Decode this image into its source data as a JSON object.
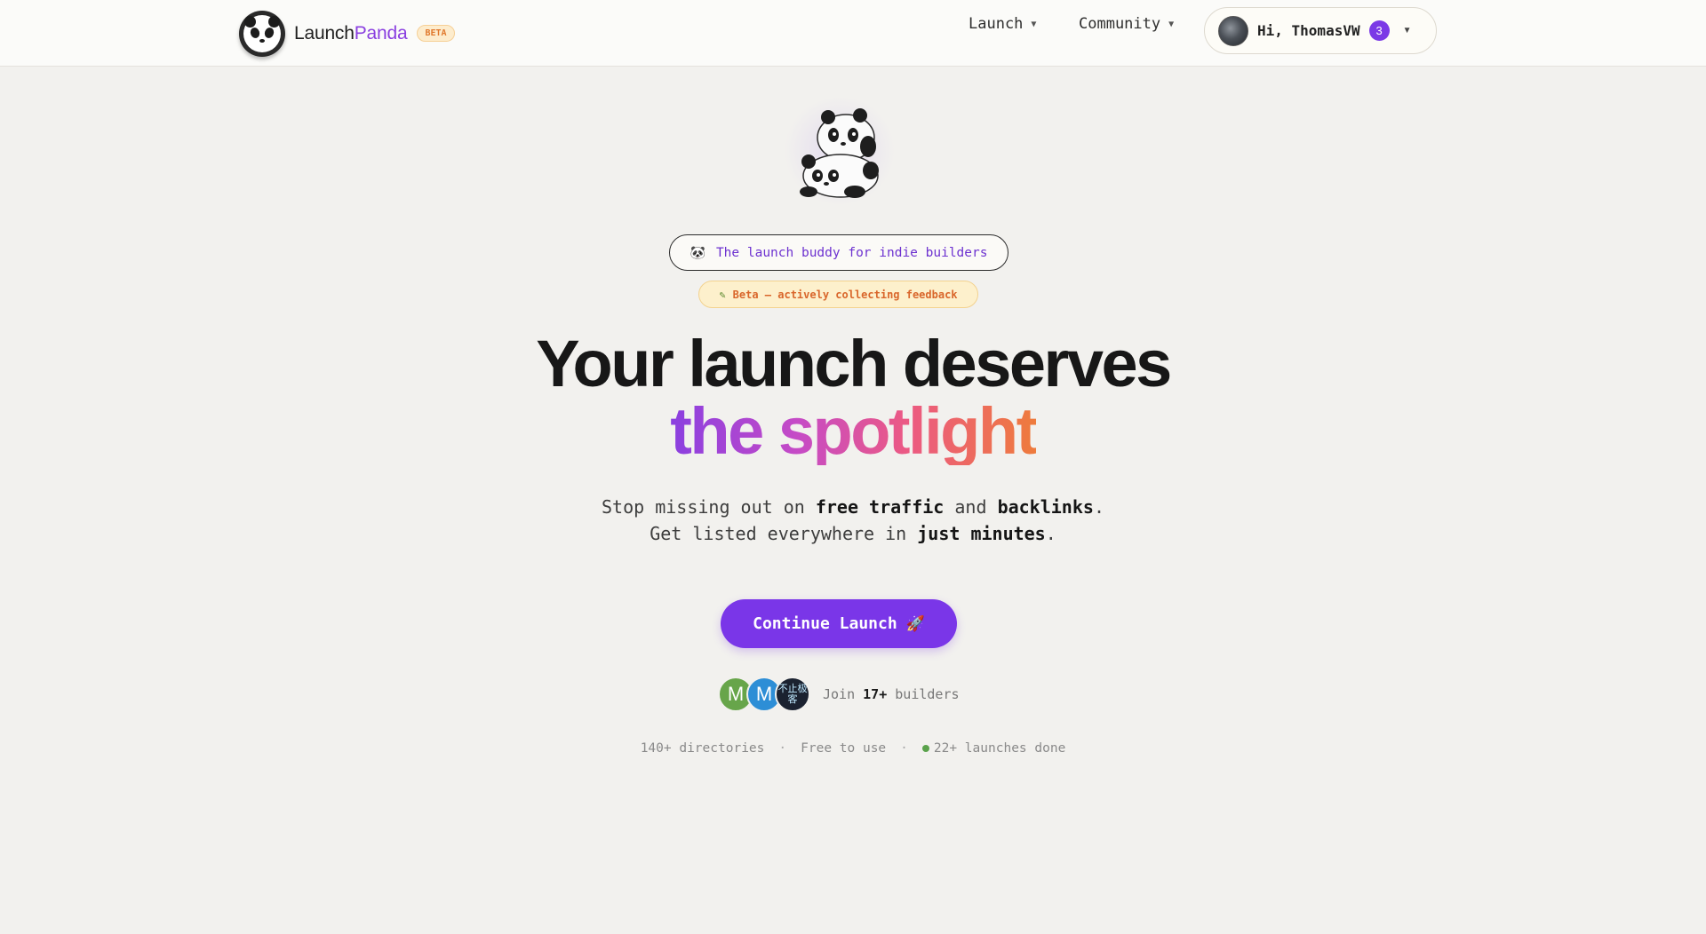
{
  "header": {
    "brand_part1": "Launch",
    "brand_part2": "Panda",
    "beta_badge": "BETA",
    "nav": [
      {
        "label": "Launch"
      },
      {
        "label": "Community"
      }
    ],
    "user": {
      "greeting": "Hi, ThomasVW",
      "notification_count": "3"
    }
  },
  "hero": {
    "tagline": "The launch buddy for indie builders",
    "beta_note": "Beta — actively collecting feedback",
    "headline_line1": "Your launch deserves",
    "headline_line2": "the spotlight",
    "subtitle": {
      "l1_a": "Stop missing out on ",
      "l1_b": "free traffic",
      "l1_c": " and ",
      "l1_d": "backlinks",
      "l1_e": ".",
      "l2_a": "Get listed everywhere in ",
      "l2_b": "just minutes",
      "l2_c": "."
    },
    "cta_label": "Continue Launch",
    "social": {
      "avatars": [
        "M",
        "M",
        "不止极客"
      ],
      "join_prefix": "Join ",
      "join_count": "17+",
      "join_suffix": " builders"
    },
    "stats": {
      "directories": "140+ directories",
      "free": "Free to use",
      "launches": "22+ launches done"
    }
  },
  "colors": {
    "accent": "#7a36e8",
    "brand_purple": "#8a3fe0",
    "gradient_end": "#ee7b3c",
    "status_green": "#5aa24b",
    "beta_orange": "#e0792d"
  },
  "icons": {
    "logo": "panda-logo-icon",
    "mascot": "panda-mascot-icon",
    "tagline": "panda-face-icon",
    "beta_note": "pencil-icon",
    "cta": "rocket-icon",
    "dropdown": "chevron-down-icon",
    "status": "status-dot-icon"
  }
}
